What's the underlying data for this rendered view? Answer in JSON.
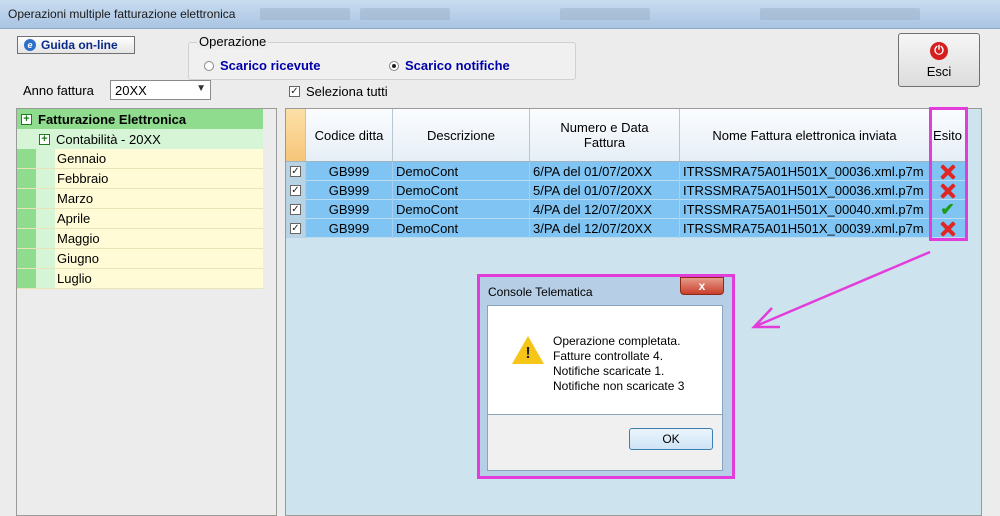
{
  "window": {
    "title": "Operazioni multiple fatturazione elettronica"
  },
  "toolbar": {
    "guida_label": "Guida on-line",
    "esci_label": "Esci"
  },
  "operazione": {
    "legend": "Operazione",
    "options": [
      {
        "label": "Scarico ricevute",
        "selected": false
      },
      {
        "label": "Scarico notifiche",
        "selected": true
      }
    ]
  },
  "anno": {
    "label": "Anno fattura",
    "value": "20XX"
  },
  "seleziona_tutti": {
    "label": "Seleziona tutti",
    "checked": true
  },
  "tree": {
    "root": "Fatturazione Elettronica",
    "sub": "Contabilità - 20XX",
    "months": [
      "Gennaio",
      "Febbraio",
      "Marzo",
      "Aprile",
      "Maggio",
      "Giugno",
      "Luglio"
    ]
  },
  "grid": {
    "headers": [
      "Codice ditta",
      "Descrizione",
      "Numero e Data Fattura",
      "Nome Fattura elettronica inviata",
      "Esito"
    ],
    "rows": [
      {
        "codice": "GB999",
        "descrizione": "DemoCont",
        "numero": "6/PA del 01/07/20XX",
        "nome": "ITRSSMRA75A01H501X_00036.xml.p7m",
        "esito": "error"
      },
      {
        "codice": "GB999",
        "descrizione": "DemoCont",
        "numero": "5/PA del 01/07/20XX",
        "nome": "ITRSSMRA75A01H501X_00036.xml.p7m",
        "esito": "error"
      },
      {
        "codice": "GB999",
        "descrizione": "DemoCont",
        "numero": "4/PA del 12/07/20XX",
        "nome": "ITRSSMRA75A01H501X_00040.xml.p7m",
        "esito": "ok"
      },
      {
        "codice": "GB999",
        "descrizione": "DemoCont",
        "numero": "3/PA del 12/07/20XX",
        "nome": "ITRSSMRA75A01H501X_00039.xml.p7m",
        "esito": "error"
      }
    ]
  },
  "dialog": {
    "title": "Console Telematica",
    "close": "x",
    "lines": [
      "Operazione completata.",
      "Fatture controllate 4.",
      "Notifiche scaricate 1.",
      "Notifiche non scaricate 3"
    ],
    "ok_label": "OK"
  },
  "colors": {
    "highlight": "#e23ddb",
    "row_selected": "#7fc4f3",
    "tree_root": "#8fdc8f"
  }
}
